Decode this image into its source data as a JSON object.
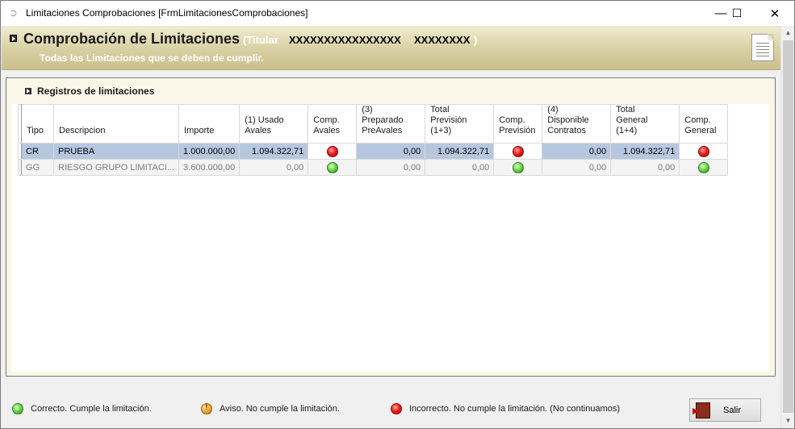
{
  "window": {
    "title": "Limitaciones Comprobaciones [FrmLimitacionesComprobaciones]",
    "minimize": "—",
    "maximize": "☐",
    "close": "✕"
  },
  "header": {
    "title": "Comprobación de Limitaciones",
    "titular_label": "(Titular",
    "titular_code_1": "XXXXXXXXXXXXXXXX",
    "titular_code_2": "XXXXXXXX",
    "titular_close": ")",
    "subtitle": "Todas las Limitaciones que se deben de cumplir."
  },
  "section": {
    "title": "Registros de limitaciones"
  },
  "table": {
    "headers": [
      [
        "Tipo"
      ],
      [
        "Descripcion"
      ],
      [
        "Importe"
      ],
      [
        "(1) Usado",
        "Avales"
      ],
      [
        "Comp.",
        "Avales"
      ],
      [
        "(3)",
        "Preparado",
        "PreAvales"
      ],
      [
        "Total",
        "Previsión",
        "(1+3)"
      ],
      [
        "Comp.",
        "Previsión"
      ],
      [
        "(4)",
        "Disponible",
        "Contratos"
      ],
      [
        "Total",
        "General",
        "(1+4)"
      ],
      [
        "Comp.",
        "General"
      ]
    ],
    "rows": [
      {
        "tipo": "CR",
        "descripcion": "PRUEBA",
        "importe": "1.000.000,00",
        "usado_avales": "1.094.322,71",
        "comp_avales": "red",
        "preparado_preavales": "0,00",
        "total_prevision": "1.094.322,71",
        "comp_prevision": "red",
        "disponible_contratos": "0,00",
        "total_general": "1.094.322,71",
        "comp_general": "red"
      },
      {
        "tipo": "GG",
        "descripcion": "RIESGO GRUPO LIMITACI...",
        "importe": "3.600.000,00",
        "usado_avales": "0,00",
        "comp_avales": "green",
        "preparado_preavales": "0,00",
        "total_prevision": "0,00",
        "comp_prevision": "green",
        "disponible_contratos": "0,00",
        "total_general": "0,00",
        "comp_general": "green"
      }
    ]
  },
  "legend": {
    "correct": "Correcto. Cumple la limitación.",
    "warning": "Aviso. No cumple la limitación.",
    "incorrect": "Incorrecto. No cumple la limitación. (No continuamos)"
  },
  "buttons": {
    "salir": "Salir"
  },
  "icons": {
    "status_ok": "green-circle-icon",
    "status_warning": "orange-warning-circle-icon",
    "status_error": "red-circle-icon",
    "exit": "exit-door-icon",
    "document": "document-icon"
  },
  "colors": {
    "header_band": "#d8d0a4",
    "panel_bg": "#faf7e8",
    "selected_row": "#b7c7df",
    "ok": "#5fd33c",
    "error": "#f21e1e",
    "warning": "#f6a623"
  }
}
